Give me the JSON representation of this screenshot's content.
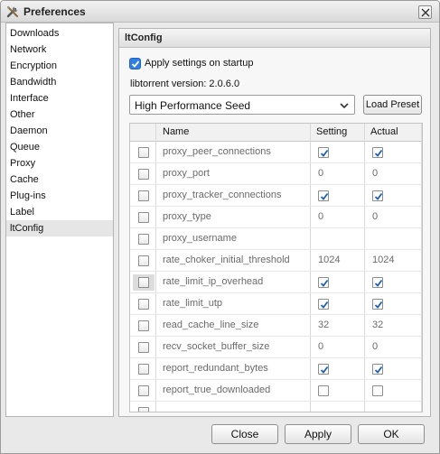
{
  "window": {
    "title": "Preferences",
    "icon": "tools-icon",
    "close_icon": "close-icon"
  },
  "sidebar": {
    "items": [
      {
        "label": "Downloads"
      },
      {
        "label": "Network"
      },
      {
        "label": "Encryption"
      },
      {
        "label": "Bandwidth"
      },
      {
        "label": "Interface"
      },
      {
        "label": "Other"
      },
      {
        "label": "Daemon"
      },
      {
        "label": "Queue"
      },
      {
        "label": "Proxy"
      },
      {
        "label": "Cache"
      },
      {
        "label": "Plug-ins"
      },
      {
        "label": "Label"
      },
      {
        "label": "ltConfig",
        "selected": true
      }
    ]
  },
  "panel": {
    "title": "ltConfig",
    "apply_on_startup": {
      "label": "Apply settings on startup",
      "checked": true
    },
    "version": "libtorrent version: 2.0.6.0",
    "preset": {
      "selected": "High Performance Seed"
    },
    "load_preset_label": "Load Preset",
    "table": {
      "columns": [
        "Name",
        "Setting",
        "Actual"
      ],
      "rows": [
        {
          "name": "proxy_peer_connections",
          "setting": true,
          "actual": true
        },
        {
          "name": "proxy_port",
          "setting": "0",
          "actual": "0"
        },
        {
          "name": "proxy_tracker_connections",
          "setting": true,
          "actual": true
        },
        {
          "name": "proxy_type",
          "setting": "0",
          "actual": "0"
        },
        {
          "name": "proxy_username",
          "setting": "",
          "actual": ""
        },
        {
          "name": "rate_choker_initial_threshold",
          "setting": "1024",
          "actual": "1024"
        },
        {
          "name": "rate_limit_ip_overhead",
          "setting": true,
          "actual": true
        },
        {
          "name": "rate_limit_utp",
          "setting": true,
          "actual": true
        },
        {
          "name": "read_cache_line_size",
          "setting": "32",
          "actual": "32"
        },
        {
          "name": "recv_socket_buffer_size",
          "setting": "0",
          "actual": "0"
        },
        {
          "name": "report_redundant_bytes",
          "setting": true,
          "actual": true
        },
        {
          "name": "report_true_downloaded",
          "setting": false,
          "actual": false
        }
      ]
    }
  },
  "footer": {
    "close_label": "Close",
    "apply_label": "Apply",
    "ok_label": "OK"
  }
}
